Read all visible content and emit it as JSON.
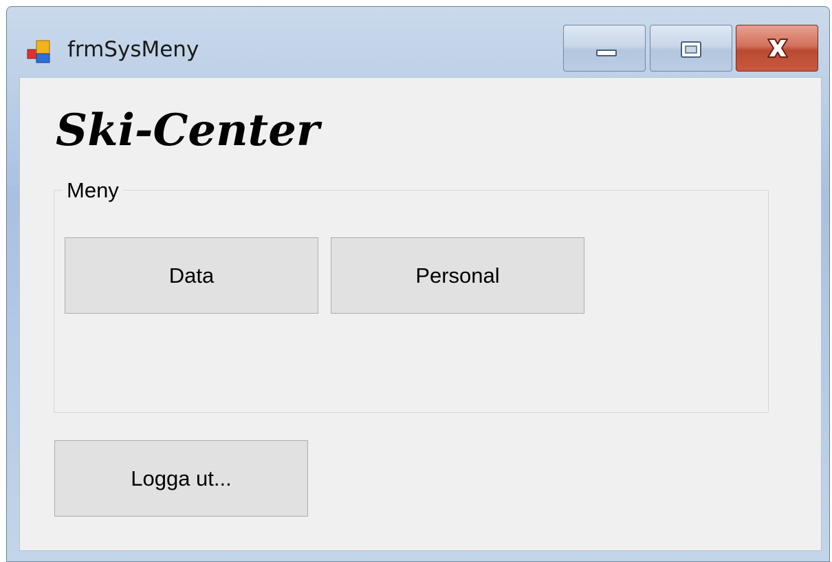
{
  "window": {
    "title": "frmSysMeny",
    "app_icon": "windows-forms-app-icon",
    "controls": {
      "minimize_icon": "minimize-icon",
      "maximize_icon": "maximize-icon",
      "close_icon": "close-icon"
    }
  },
  "logo": {
    "text": "Ski-Center"
  },
  "menu_group": {
    "label": "Meny",
    "buttons": [
      {
        "label": "Data"
      },
      {
        "label": "Personal"
      }
    ]
  },
  "logout_button": {
    "label": "Logga ut..."
  },
  "colors": {
    "titlebar": "#b9cde5",
    "client_background": "#f0f0f0",
    "button_face": "#e1e1e1",
    "close_button": "#c85a3e"
  }
}
